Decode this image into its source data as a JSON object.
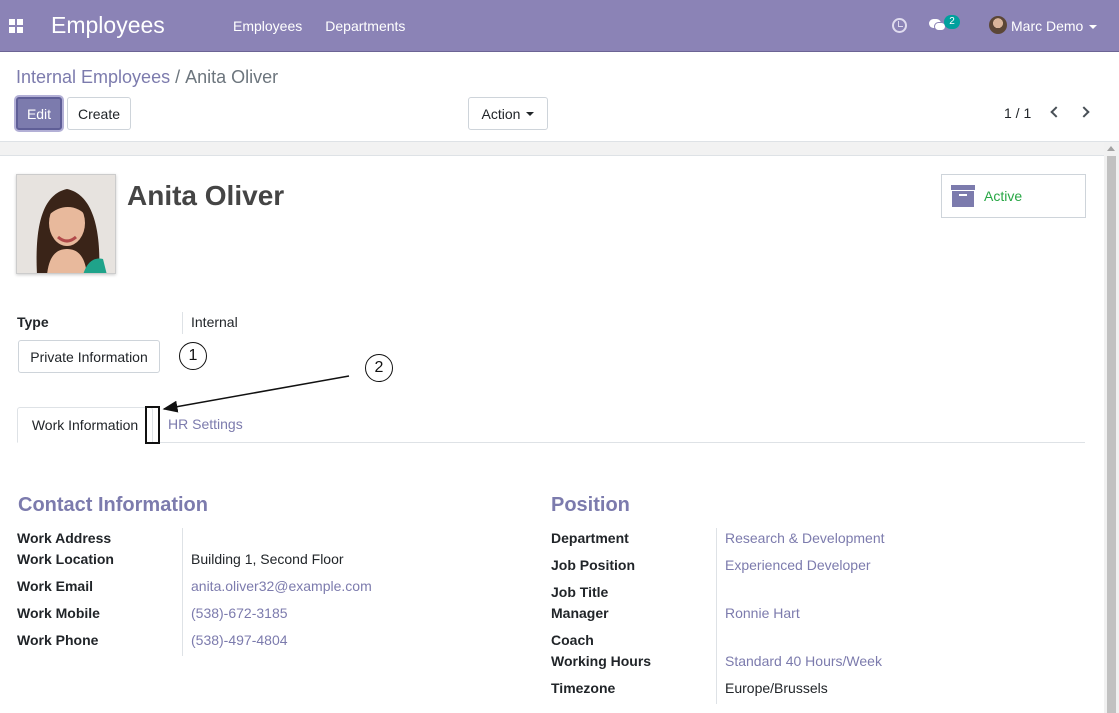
{
  "navbar": {
    "app_title": "Employees",
    "menu": [
      "Employees",
      "Departments"
    ],
    "chat_count": "2",
    "user_name": "Marc Demo"
  },
  "breadcrumb": {
    "parent": "Internal Employees",
    "separator": "/",
    "current": "Anita Oliver"
  },
  "toolbar": {
    "edit_label": "Edit",
    "create_label": "Create",
    "action_label": "Action"
  },
  "pager": {
    "text": "1 / 1"
  },
  "employee": {
    "name": "Anita Oliver",
    "status_label": "Active",
    "type_label": "Type",
    "type_value": "Internal",
    "private_info_label": "Private Information"
  },
  "annotations": {
    "one": "1",
    "two": "2"
  },
  "tabs": {
    "work_info": "Work Information",
    "hr_settings": "HR Settings"
  },
  "contact": {
    "title": "Contact Information",
    "work_address_label": "Work Address",
    "work_location_label": "Work Location",
    "work_location_value": "Building 1, Second Floor",
    "work_email_label": "Work Email",
    "work_email_value": "anita.oliver32@example.com",
    "work_mobile_label": "Work Mobile",
    "work_mobile_value": "(538)-672-3185",
    "work_phone_label": "Work Phone",
    "work_phone_value": "(538)-497-4804"
  },
  "position": {
    "title": "Position",
    "department_label": "Department",
    "department_value": "Research & Development",
    "job_position_label": "Job Position",
    "job_position_value": "Experienced Developer",
    "job_title_label": "Job Title",
    "manager_label": "Manager",
    "manager_value": "Ronnie Hart",
    "coach_label": "Coach",
    "working_hours_label": "Working Hours",
    "working_hours_value": "Standard 40 Hours/Week",
    "timezone_label": "Timezone",
    "timezone_value": "Europe/Brussels"
  },
  "colors": {
    "navbar": "#8b83b6",
    "accent": "#7c7bad",
    "active_green": "#28a745",
    "chat_badge": "#00a09d"
  }
}
